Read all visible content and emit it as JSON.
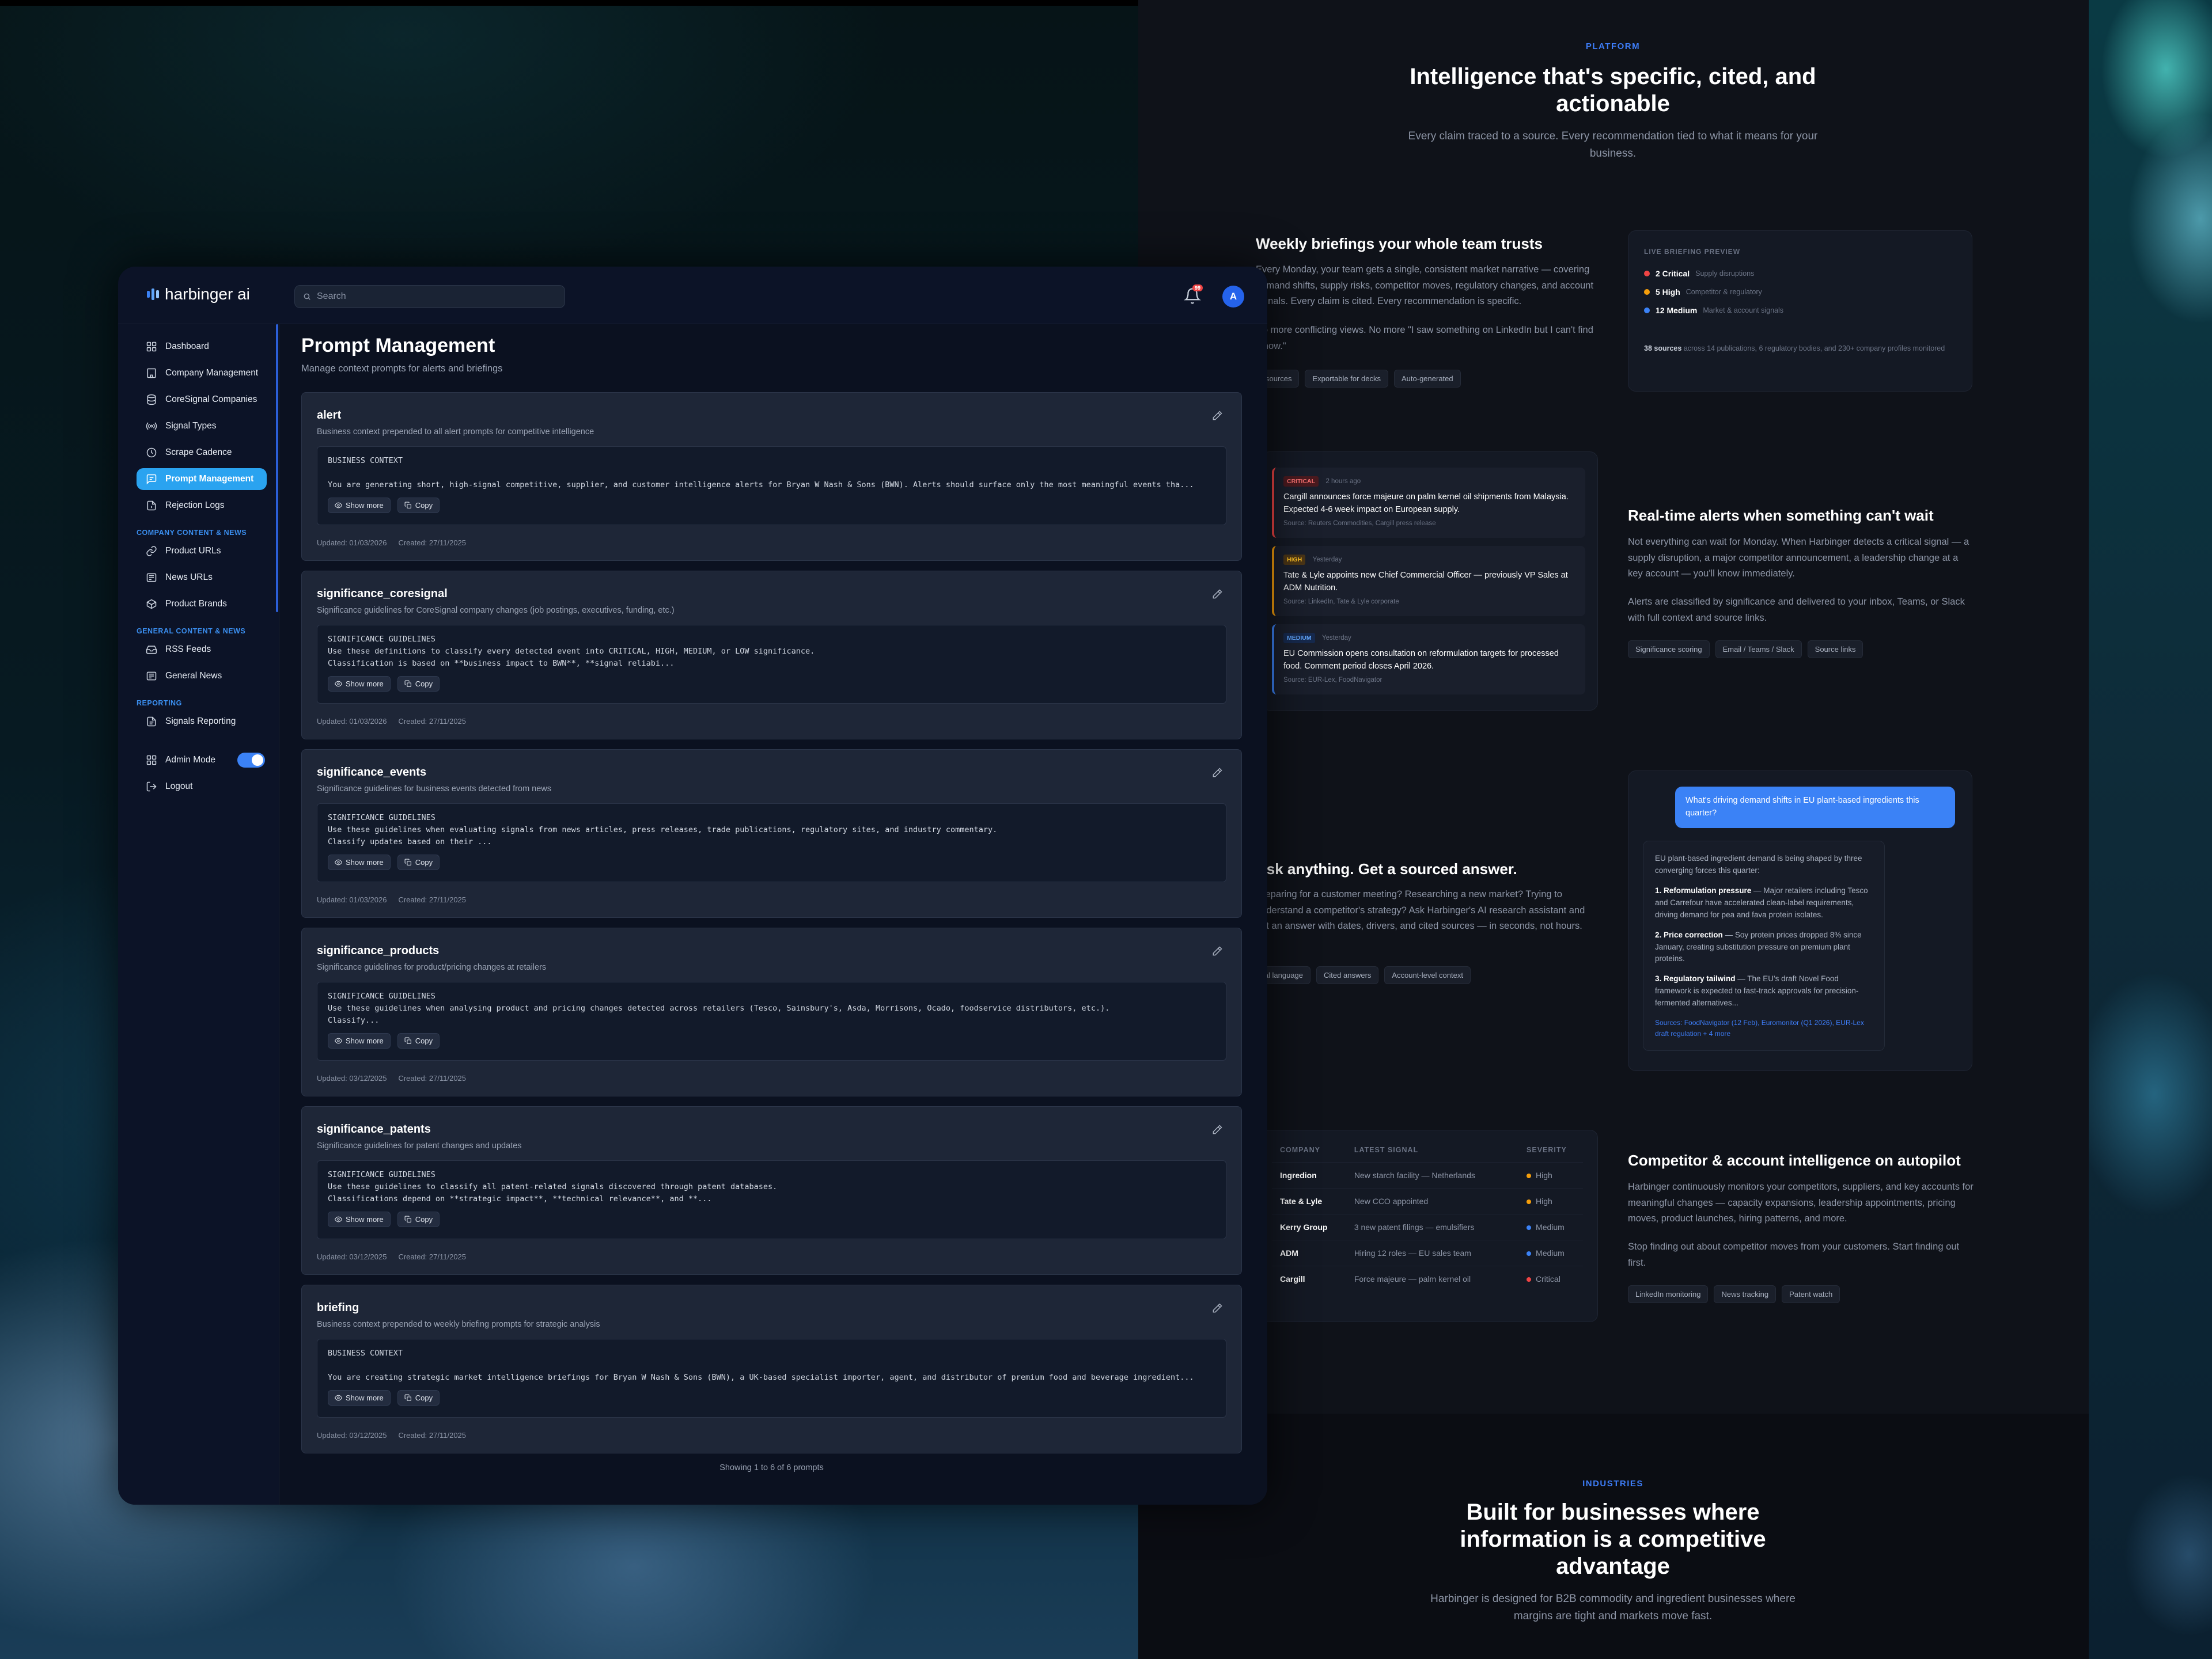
{
  "marketing": {
    "eyebrow": "PLATFORM",
    "headline_1": "Intelligence that's specific, cited, and",
    "headline_2": "actionable",
    "subhead_1": "Every claim traced to a source. Every recommendation tied to what it means for your",
    "subhead_2": "business.",
    "feature_briefings": {
      "title": "Weekly briefings your whole team trusts",
      "body_1": "Every Monday, your team gets a single, consistent market narrative — covering demand shifts, supply risks, competitor moves, regulatory changes, and account signals. Every claim is cited. Every recommendation is specific.",
      "body_2": "No more conflicting views. No more \"I saw something on LinkedIn but I can't find it now.\"",
      "tags": [
        "Cited sources",
        "Exportable for decks",
        "Auto-generated"
      ]
    },
    "briefing_preview": {
      "label": "LIVE BRIEFING PREVIEW",
      "rows": [
        {
          "count": "2 Critical",
          "desc": "Supply disruptions",
          "color": "#ef4444"
        },
        {
          "count": "5 High",
          "desc": "Competitor & regulatory",
          "color": "#f59e0b"
        },
        {
          "count": "12 Medium",
          "desc": "Market & account signals",
          "color": "#3b82f6"
        }
      ],
      "sources_bold": "38 sources",
      "sources_rest": "across 14 publications, 6 regulatory bodies, and 230+ company profiles monitored"
    },
    "alerts": [
      {
        "severity": "CRITICAL",
        "time": "2 hours ago",
        "text": "Cargill announces force majeure on palm kernel oil shipments from Malaysia. Expected 4-6 week impact on European supply.",
        "source": "Source: Reuters Commodities, Cargill press release",
        "color": "#ef4444",
        "bg": "#4a1a1f",
        "fg": "#f87171"
      },
      {
        "severity": "HIGH",
        "time": "Yesterday",
        "text": "Tate & Lyle appoints new Chief Commercial Officer — previously VP Sales at ADM Nutrition.",
        "source": "Source: LinkedIn, Tate & Lyle corporate",
        "color": "#f59e0b",
        "bg": "#4a3516",
        "fg": "#fbbf24"
      },
      {
        "severity": "MEDIUM",
        "time": "Yesterday",
        "text": "EU Commission opens consultation on reformulation targets for processed food. Comment period closes April 2026.",
        "source": "Source: EUR-Lex, FoodNavigator",
        "color": "#3b82f6",
        "bg": "#16294d",
        "fg": "#60a5fa"
      }
    ],
    "feature_alerts": {
      "title": "Real-time alerts when something can't wait",
      "body_1": "Not everything can wait for Monday. When Harbinger detects a critical signal — a supply disruption, a major competitor announcement, a leadership change at a key account — you'll know immediately.",
      "body_2": "Alerts are classified by significance and delivered to your inbox, Teams, or Slack with full context and source links.",
      "tags": [
        "Significance scoring",
        "Email / Teams / Slack",
        "Source links"
      ]
    },
    "chat": {
      "question": "What's driving demand shifts in EU plant-based ingredients this quarter?",
      "intro": "EU plant-based ingredient demand is being shaped by three converging forces this quarter:",
      "p1_bold": "1. Reformulation pressure",
      "p1_rest": " — Major retailers including Tesco and Carrefour have accelerated clean-label requirements, driving demand for pea and fava protein isolates.",
      "p2_bold": "2. Price correction",
      "p2_rest": " — Soy protein prices dropped 8% since January, creating substitution pressure on premium plant proteins.",
      "p3_bold": "3. Regulatory tailwind",
      "p3_rest": " — The EU's draft Novel Food framework is expected to fast-track approvals for precision-fermented alternatives...",
      "sources": "Sources: FoodNavigator (12 Feb), Euromonitor (Q1 2026), EUR-Lex draft regulation + 4 more"
    },
    "feature_ask": {
      "title": "Ask anything. Get a sourced answer.",
      "body": "Preparing for a customer meeting? Researching a new market? Trying to understand a competitor's strategy? Ask Harbinger's AI research assistant and get an answer with dates, drivers, and cited sources — in seconds, not hours.",
      "tags": [
        "Natural language",
        "Cited answers",
        "Account-level context"
      ]
    },
    "company_table": {
      "headers": [
        "COMPANY",
        "LATEST SIGNAL",
        "SEVERITY"
      ],
      "rows": [
        {
          "company": "Ingredion",
          "signal": "New starch facility — Netherlands",
          "severity": "High",
          "color": "#f59e0b"
        },
        {
          "company": "Tate & Lyle",
          "signal": "New CCO appointed",
          "severity": "High",
          "color": "#f59e0b"
        },
        {
          "company": "Kerry Group",
          "signal": "3 new patent filings — emulsifiers",
          "severity": "Medium",
          "color": "#3b82f6"
        },
        {
          "company": "ADM",
          "signal": "Hiring 12 roles — EU sales team",
          "severity": "Medium",
          "color": "#3b82f6"
        },
        {
          "company": "Cargill",
          "signal": "Force majeure — palm kernel oil",
          "severity": "Critical",
          "color": "#ef4444"
        }
      ]
    },
    "feature_competitor": {
      "title": "Competitor & account intelligence on autopilot",
      "body_1": "Harbinger continuously monitors your competitors, suppliers, and key accounts for meaningful changes — capacity expansions, leadership appointments, pricing moves, product launches, hiring patterns, and more.",
      "body_2": "Stop finding out about competitor moves from your customers. Start finding out first.",
      "tags": [
        "LinkedIn monitoring",
        "News tracking",
        "Patent watch"
      ]
    },
    "industries": {
      "eyebrow": "INDUSTRIES",
      "headline_1": "Built for businesses where",
      "headline_2": "information is a competitive",
      "headline_3": "advantage",
      "sub_1": "Harbinger is designed for B2B commodity and ingredient businesses where",
      "sub_2": "margins are tight and markets move fast."
    }
  },
  "app": {
    "logo_text": "harbinger ai",
    "search_placeholder": "Search",
    "notification_count": "99",
    "avatar_initial": "A",
    "nav": [
      {
        "label": "Dashboard",
        "icon": "grid-icon"
      },
      {
        "label": "Company Management",
        "icon": "building-icon"
      },
      {
        "label": "CoreSignal Companies",
        "icon": "database-icon"
      },
      {
        "label": "Signal Types",
        "icon": "radio-icon"
      },
      {
        "label": "Scrape Cadence",
        "icon": "clock-icon"
      },
      {
        "label": "Prompt Management",
        "icon": "message-icon"
      },
      {
        "label": "Rejection Logs",
        "icon": "file-icon"
      }
    ],
    "section_company_content": "COMPANY CONTENT & NEWS",
    "nav_company_content": [
      {
        "label": "Product URLs",
        "icon": "link-icon"
      },
      {
        "label": "News URLs",
        "icon": "newspaper-icon"
      },
      {
        "label": "Product Brands",
        "icon": "package-icon"
      }
    ],
    "section_general": "GENERAL CONTENT & NEWS",
    "nav_general": [
      {
        "label": "RSS Feeds",
        "icon": "inbox-icon"
      },
      {
        "label": "General News",
        "icon": "newspaper-icon"
      }
    ],
    "section_reporting": "REPORTING",
    "nav_reporting": [
      {
        "label": "Signals Reporting",
        "icon": "file-icon"
      }
    ],
    "admin_mode_label": "Admin Mode",
    "logout_label": "Logout",
    "page_title": "Prompt Management",
    "page_subtitle": "Manage context prompts for alerts and briefings",
    "show_more_label": "Show more",
    "copy_label": "Copy",
    "prompts": [
      {
        "name": "alert",
        "desc": "Business context prepended to all alert prompts for competitive intelligence",
        "text": "BUSINESS CONTEXT\n\nYou are generating short, high-signal competitive, supplier, and customer intelligence alerts for Bryan W Nash & Sons (BWN). Alerts should surface only the most meaningful events tha...",
        "updated": "Updated: 01/03/2026",
        "created": "Created: 27/11/2025"
      },
      {
        "name": "significance_coresignal",
        "desc": "Significance guidelines for CoreSignal company changes (job postings, executives, funding, etc.)",
        "text": "SIGNIFICANCE GUIDELINES\nUse these definitions to classify every detected event into CRITICAL, HIGH, MEDIUM, or LOW significance.\nClassification is based on **business impact to BWN**, **signal reliabi...",
        "updated": "Updated: 01/03/2026",
        "created": "Created: 27/11/2025"
      },
      {
        "name": "significance_events",
        "desc": "Significance guidelines for business events detected from news",
        "text": "SIGNIFICANCE GUIDELINES\nUse these guidelines when evaluating signals from news articles, press releases, trade publications, regulatory sites, and industry commentary.\nClassify updates based on their ...",
        "updated": "Updated: 01/03/2026",
        "created": "Created: 27/11/2025"
      },
      {
        "name": "significance_products",
        "desc": "Significance guidelines for product/pricing changes at retailers",
        "text": "SIGNIFICANCE GUIDELINES\nUse these guidelines when analysing product and pricing changes detected across retailers (Tesco, Sainsbury's, Asda, Morrisons, Ocado, foodservice distributors, etc.).\nClassify...",
        "updated": "Updated: 03/12/2025",
        "created": "Created: 27/11/2025"
      },
      {
        "name": "significance_patents",
        "desc": "Significance guidelines for patent changes and updates",
        "text": "SIGNIFICANCE GUIDELINES\nUse these guidelines to classify all patent-related signals discovered through patent databases.\nClassifications depend on **strategic impact**, **technical relevance**, and **...",
        "updated": "Updated: 03/12/2025",
        "created": "Created: 27/11/2025"
      },
      {
        "name": "briefing",
        "desc": "Business context prepended to weekly briefing prompts for strategic analysis",
        "text": "BUSINESS CONTEXT\n\nYou are creating strategic market intelligence briefings for Bryan W Nash & Sons (BWN), a UK-based specialist importer, agent, and distributor of premium food and beverage ingredient...",
        "updated": "Updated: 03/12/2025",
        "created": "Created: 27/11/2025"
      }
    ],
    "footer_note": "Showing 1 to 6 of 6 prompts"
  }
}
